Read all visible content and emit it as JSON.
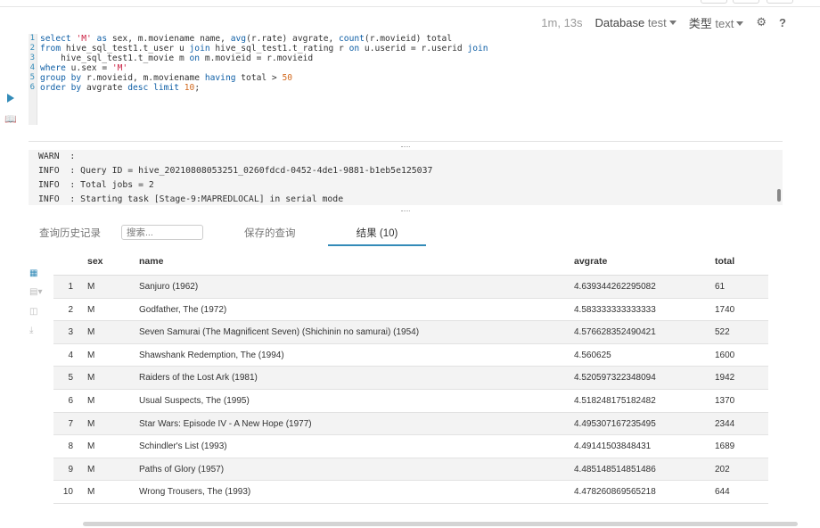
{
  "toolbar": {
    "elapsed": "1m, 13s",
    "database_label": "Database",
    "database_value": "test",
    "type_label": "类型",
    "type_value": "text",
    "settings_icon": "gear-icon",
    "help_icon": "question-icon"
  },
  "editor": {
    "line_numbers": [
      "1",
      "2",
      "3",
      "4",
      "5",
      "6"
    ]
  },
  "log": {
    "lines": [
      "WARN  :",
      "INFO  : Query ID = hive_20210808053251_0260fdcd-0452-4de1-9881-b1eb5e125037",
      "INFO  : Total jobs = 2",
      "INFO  : Starting task [Stage-9:MAPREDLOCAL] in serial mode"
    ]
  },
  "tabs": {
    "history": "查询历史记录",
    "search_placeholder": "搜索...",
    "saved": "保存的查询",
    "results": "结果 (10)"
  },
  "results": {
    "columns": [
      "sex",
      "name",
      "avgrate",
      "total"
    ],
    "rows": [
      {
        "idx": "1",
        "sex": "M",
        "name": "Sanjuro (1962)",
        "avgrate": "4.639344262295082",
        "total": "61"
      },
      {
        "idx": "2",
        "sex": "M",
        "name": "Godfather, The (1972)",
        "avgrate": "4.583333333333333",
        "total": "1740"
      },
      {
        "idx": "3",
        "sex": "M",
        "name": "Seven Samurai (The Magnificent Seven) (Shichinin no samurai) (1954)",
        "avgrate": "4.576628352490421",
        "total": "522"
      },
      {
        "idx": "4",
        "sex": "M",
        "name": "Shawshank Redemption, The (1994)",
        "avgrate": "4.560625",
        "total": "1600"
      },
      {
        "idx": "5",
        "sex": "M",
        "name": "Raiders of the Lost Ark (1981)",
        "avgrate": "4.520597322348094",
        "total": "1942"
      },
      {
        "idx": "6",
        "sex": "M",
        "name": "Usual Suspects, The (1995)",
        "avgrate": "4.518248175182482",
        "total": "1370"
      },
      {
        "idx": "7",
        "sex": "M",
        "name": "Star Wars: Episode IV - A New Hope (1977)",
        "avgrate": "4.495307167235495",
        "total": "2344"
      },
      {
        "idx": "8",
        "sex": "M",
        "name": "Schindler's List (1993)",
        "avgrate": "4.49141503848431",
        "total": "1689"
      },
      {
        "idx": "9",
        "sex": "M",
        "name": "Paths of Glory (1957)",
        "avgrate": "4.485148514851486",
        "total": "202"
      },
      {
        "idx": "10",
        "sex": "M",
        "name": "Wrong Trousers, The (1993)",
        "avgrate": "4.478260869565218",
        "total": "644"
      }
    ]
  },
  "colors": {
    "accent": "#338bb8",
    "keyword": "#0f5fa6",
    "string": "#cc2244",
    "number": "#d2691e"
  }
}
